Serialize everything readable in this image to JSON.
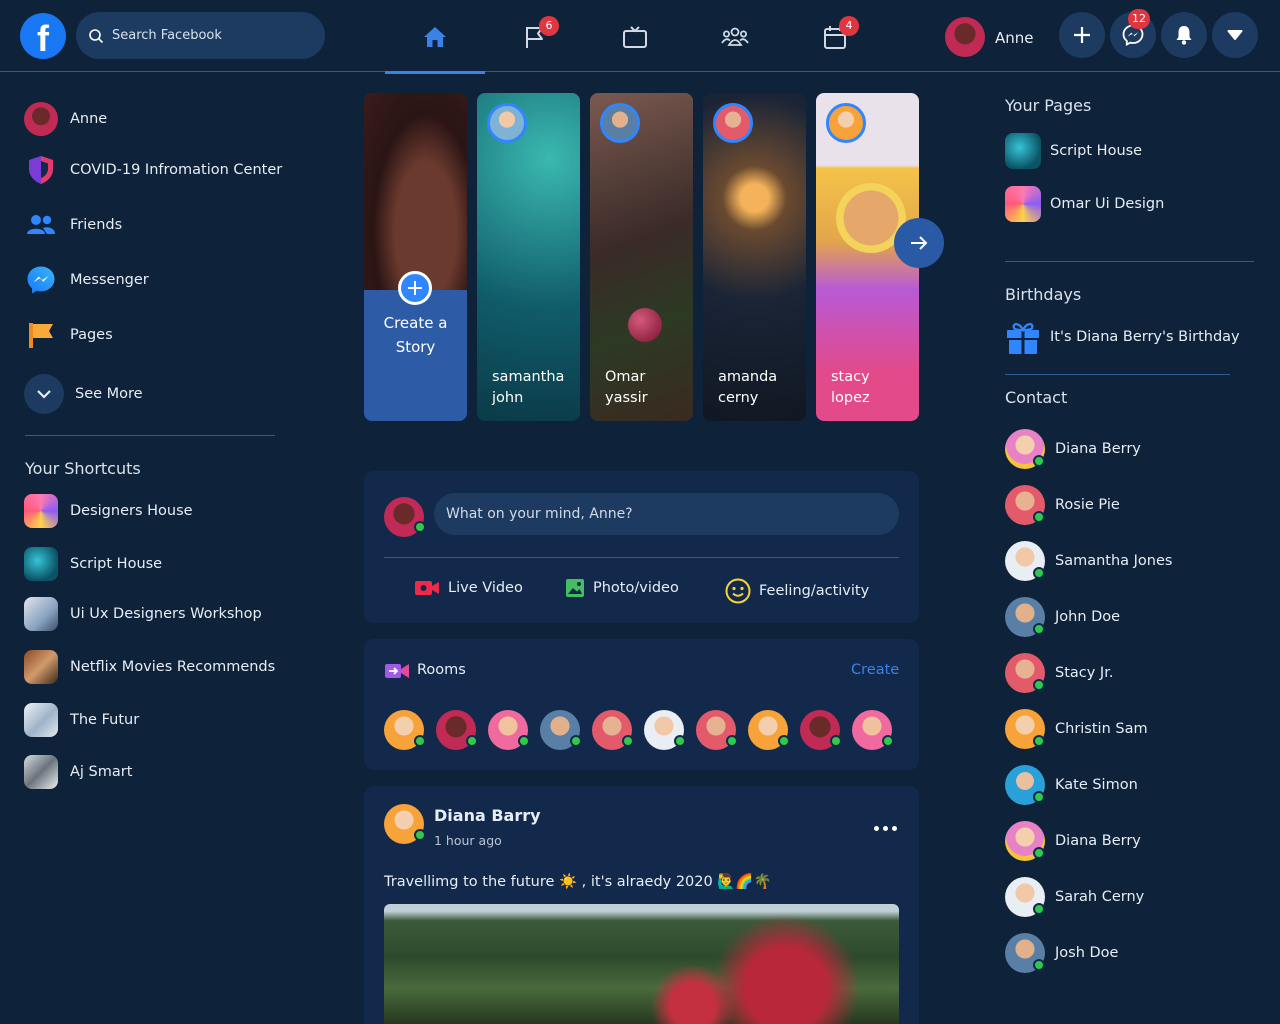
{
  "header": {
    "logo_letter": "f",
    "search_placeholder": "Search Facebook",
    "badges": {
      "flag": "6",
      "calendar": "4",
      "messenger": "12"
    },
    "user_name": "Anne"
  },
  "left": {
    "profile_name": "Anne",
    "items": [
      {
        "label": "COVID-19 Infromation Center"
      },
      {
        "label": "Friends"
      },
      {
        "label": "Messenger"
      },
      {
        "label": "Pages"
      },
      {
        "label": "See More"
      }
    ],
    "shortcuts_title": "Your Shortcuts",
    "shortcuts": [
      {
        "label": "Designers House"
      },
      {
        "label": "Script House"
      },
      {
        "label": "Ui Ux Designers Workshop"
      },
      {
        "label": "Netflix Movies Recommends"
      },
      {
        "label": "The Futur"
      },
      {
        "label": "Aj Smart"
      }
    ]
  },
  "stories": {
    "create_line1": "Create a",
    "create_line2": "Story",
    "items": [
      {
        "first": "samantha",
        "last": "john"
      },
      {
        "first": "Omar",
        "last": "yassir"
      },
      {
        "first": "amanda",
        "last": "cerny"
      },
      {
        "first": "stacy",
        "last": "lopez"
      }
    ]
  },
  "composer": {
    "placeholder": "What on your mind, Anne?",
    "live_video": "Live Video",
    "photo_video": "Photo/video",
    "feeling": "Feeling/activity"
  },
  "rooms": {
    "title": "Rooms",
    "create": "Create"
  },
  "post": {
    "author": "Diana Barry",
    "time": "1 hour ago",
    "text": "Travellimg to the future ☀️ , it's alraedy 2020 🙋‍♂️🌈🌴"
  },
  "right": {
    "pages_title": "Your Pages",
    "pages": [
      {
        "label": "Script House"
      },
      {
        "label": "Omar Ui Design"
      }
    ],
    "birthdays_title": "Birthdays",
    "birthday_text": "It's Diana Berry's Birthday",
    "contact_title": "Contact",
    "contacts": [
      {
        "name": "Diana Berry"
      },
      {
        "name": "Rosie Pie"
      },
      {
        "name": "Samantha Jones"
      },
      {
        "name": "John Doe"
      },
      {
        "name": "Stacy Jr."
      },
      {
        "name": "Christin Sam"
      },
      {
        "name": "Kate Simon"
      },
      {
        "name": "Diana Berry"
      },
      {
        "name": "Sarah Cerny"
      },
      {
        "name": "Josh Doe"
      }
    ]
  },
  "colors": {
    "accent": "#3b82e6",
    "background": "#0e2239",
    "card": "#13294b",
    "online": "#30c94a",
    "badge": "#e0363f"
  }
}
